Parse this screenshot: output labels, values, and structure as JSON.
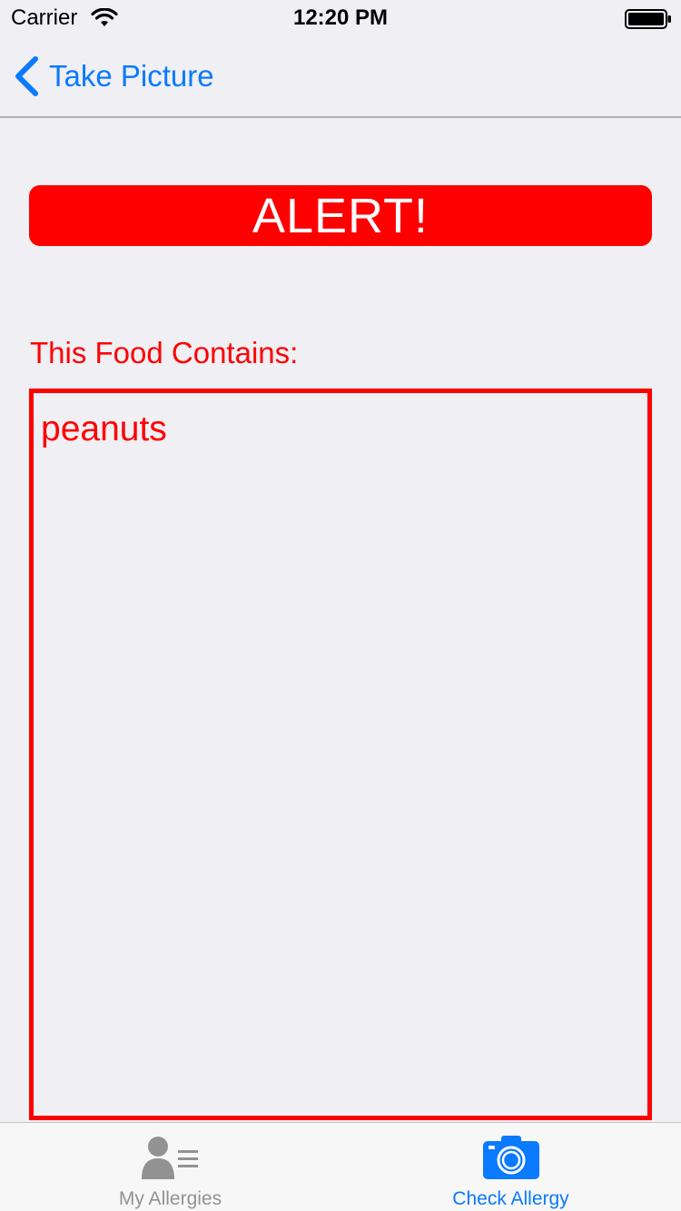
{
  "status_bar": {
    "carrier": "Carrier",
    "time": "12:20 PM"
  },
  "nav_bar": {
    "back_label": "Take Picture"
  },
  "alert": {
    "text": "ALERT!"
  },
  "contents": {
    "label": "This Food Contains:",
    "allergens_text": "peanuts"
  },
  "tab_bar": {
    "tabs": [
      {
        "label": "My Allergies",
        "icon": "contact-list-icon",
        "active": false
      },
      {
        "label": "Check Allergy",
        "icon": "camera-icon",
        "active": true
      }
    ]
  },
  "colors": {
    "accent": "#0a7aff",
    "alert": "#ff0000",
    "background": "#efeff4",
    "inactive_tab": "#929292"
  }
}
